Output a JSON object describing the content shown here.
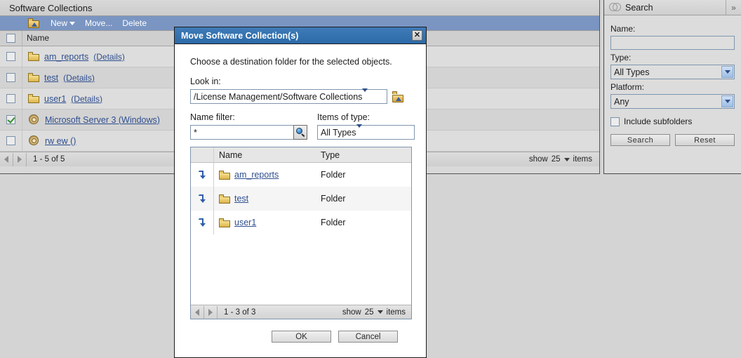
{
  "page": {
    "title": "Software Collections"
  },
  "toolbar": {
    "up_icon": "folder-up-icon",
    "new_label": "New",
    "move_label": "Move...",
    "delete_label": "Delete"
  },
  "list": {
    "header_name": "Name",
    "rows": [
      {
        "checked": false,
        "icon": "folder-icon",
        "name": "am_reports",
        "details": "(Details)"
      },
      {
        "checked": false,
        "icon": "folder-icon",
        "name": "test",
        "details": "(Details)"
      },
      {
        "checked": false,
        "icon": "folder-icon",
        "name": "user1",
        "details": "(Details)"
      },
      {
        "checked": true,
        "icon": "snail-icon",
        "name": "Microsoft Server 3 (Windows)",
        "details": ""
      },
      {
        "checked": false,
        "icon": "snail-icon",
        "name": "rw ew ()",
        "details": ""
      }
    ],
    "pager": {
      "range": "1 - 5 of 5",
      "show_label": "show",
      "count": "25",
      "items_label": "items"
    }
  },
  "search": {
    "title": "Search",
    "icon": "rings-icon",
    "expand_label": "»",
    "name_label": "Name:",
    "name_value": "",
    "name_placeholder": "",
    "type_label": "Type:",
    "type_value": "All Types",
    "platform_label": "Platform:",
    "platform_value": "Any",
    "include_subfolders_label": "Include subfolders",
    "include_subfolders_checked": false,
    "search_button": "Search",
    "reset_button": "Reset"
  },
  "dialog": {
    "title": "Move Software Collection(s)",
    "close_label": "✕",
    "instruction": "Choose a destination folder for the selected objects.",
    "lookin_label": "Look in:",
    "lookin_value": "/License Management/Software Collections",
    "namefilter_label": "Name filter:",
    "namefilter_value": "*",
    "itemstype_label": "Items of type:",
    "itemstype_value": "All Types",
    "table": {
      "col_name": "Name",
      "col_type": "Type",
      "rows": [
        {
          "name": "am_reports",
          "type": "Folder"
        },
        {
          "name": "test",
          "type": "Folder"
        },
        {
          "name": "user1",
          "type": "Folder"
        }
      ],
      "pager": {
        "range": "1 - 3 of 3",
        "show_label": "show",
        "count": "25",
        "items_label": "items"
      }
    },
    "ok_button": "OK",
    "cancel_button": "Cancel"
  }
}
